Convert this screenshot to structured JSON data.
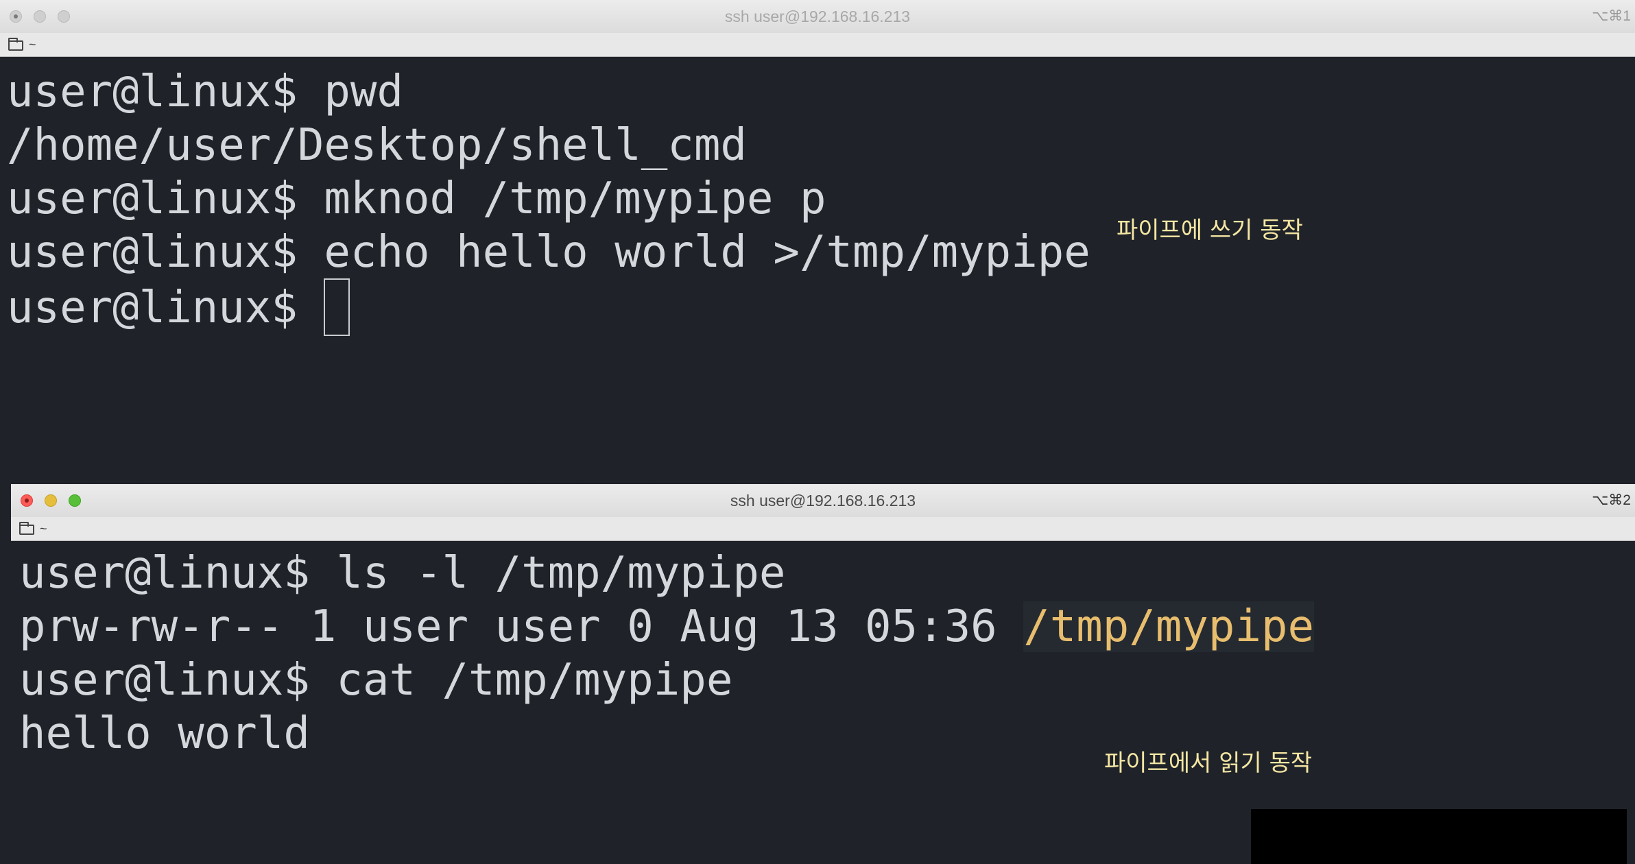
{
  "windows": [
    {
      "title": "ssh user@192.168.16.213",
      "shortcut": "⌥⌘1",
      "tab_path": "~",
      "state": "inactive",
      "lines": [
        {
          "prompt": "user@linux$ ",
          "command": "pwd"
        },
        {
          "output": "/home/user/Desktop/shell_cmd"
        },
        {
          "prompt": "user@linux$ ",
          "command": "mknod /tmp/mypipe p"
        },
        {
          "prompt": "user@linux$ ",
          "command": "echo hello world >/tmp/mypipe"
        },
        {
          "prompt": "user@linux$ ",
          "command": "",
          "cursor": true
        }
      ],
      "caption": "파이프에 쓰기 동작"
    },
    {
      "title": "ssh user@192.168.16.213",
      "shortcut": "⌥⌘2",
      "tab_path": "~",
      "state": "active",
      "lines": [
        {
          "prompt": "user@linux$ ",
          "command": "ls -l /tmp/mypipe"
        },
        {
          "output": "prw-rw-r-- 1 user user 0 Aug 13 05:36 ",
          "highlight": "/tmp/mypipe"
        },
        {
          "prompt": "user@linux$ ",
          "command": "cat /tmp/mypipe"
        },
        {
          "output": "hello world"
        }
      ],
      "caption": "파이프에서 읽기 동작"
    }
  ],
  "colors": {
    "terminal_bg": "#1f2329",
    "terminal_fg": "#d4d7db",
    "highlight_fg": "#e8be6e",
    "caption": "#f5e6a3",
    "close_button": "#fc5b57",
    "minimize_button": "#e5bf3c",
    "maximize_button": "#57c038"
  },
  "icons": {
    "tab_icon": "folder-icon",
    "window_controls": [
      "close-button",
      "minimize-button",
      "maximize-button"
    ]
  }
}
